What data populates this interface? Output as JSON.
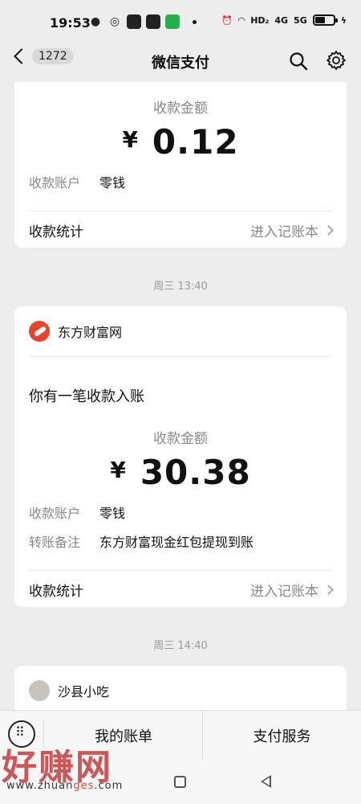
{
  "status_bar": {
    "time": "19:53",
    "network_label": "HD₂",
    "signal_4g": "4G",
    "signal_5g": "5G"
  },
  "nav": {
    "back_badge": "1272",
    "title": "微信支付"
  },
  "card1": {
    "amount_label": "收款金额",
    "currency": "¥",
    "amount": "0.12",
    "account_key": "收款账户",
    "account_value": "零钱",
    "stats_label": "收款统计",
    "stats_link": "进入记账本"
  },
  "sep1": "周三 13:40",
  "card2": {
    "merchant": "东方财富网",
    "message": "你有一笔收款入账",
    "amount_label": "收款金额",
    "currency": "¥",
    "amount": "30.38",
    "account_key": "收款账户",
    "account_value": "零钱",
    "note_key": "转账备注",
    "note_value": "东方财富现金红包提现到账",
    "stats_label": "收款统计",
    "stats_link": "进入记账本"
  },
  "sep2": "周三 14:40",
  "card3": {
    "merchant": "沙县小吃"
  },
  "bottom_tabs": {
    "tab1": "我的账单",
    "tab2": "支付服务"
  },
  "watermark": {
    "big": "好赚网",
    "url_pre": "www.zhuan",
    "url_hl": "ges",
    "url_post": ".com"
  },
  "colors": {
    "background": "#ededed",
    "card": "#ffffff",
    "muted": "#888888",
    "merchant_logo": "#e8442b"
  },
  "icons": [
    "back-icon",
    "search-icon",
    "gear-icon",
    "keyboard-icon",
    "home-icon",
    "back-triangle-icon"
  ]
}
